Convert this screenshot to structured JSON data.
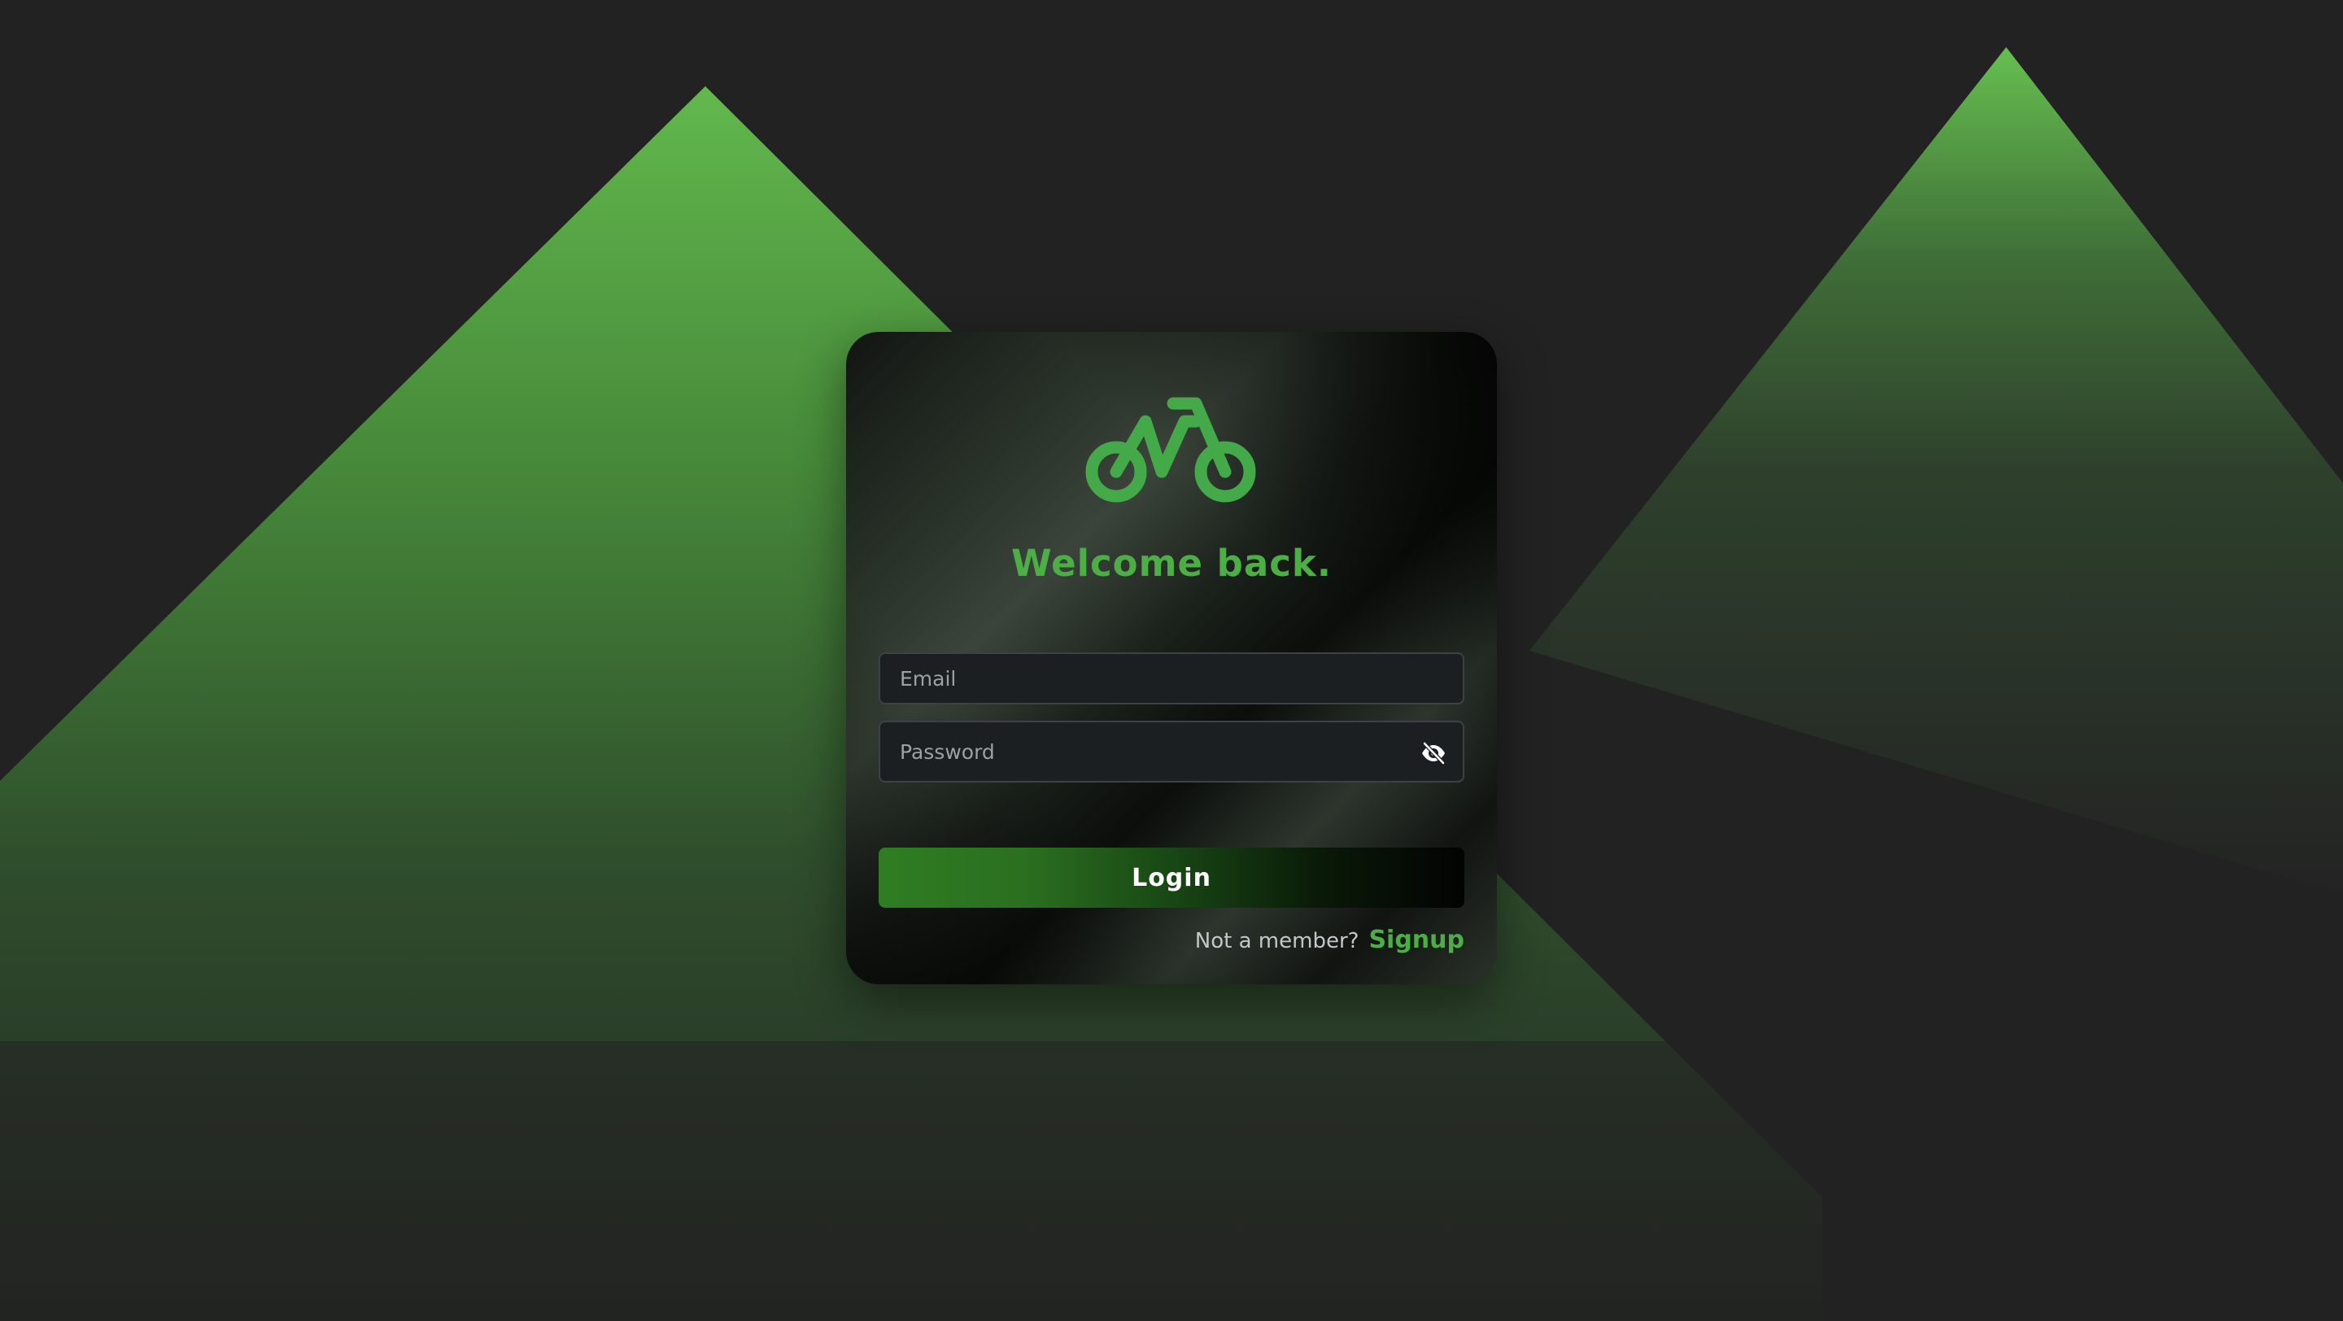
{
  "background": {
    "color": "#222222",
    "accent": "#5fb84f"
  },
  "login_card": {
    "logo_icon": "bicycle-logo-icon",
    "title": "Welcome back.",
    "email": {
      "placeholder": "Email",
      "value": ""
    },
    "password": {
      "placeholder": "Password",
      "value": "",
      "toggle_icon": "eye-slash-icon"
    },
    "login_label": "Login",
    "signup_prompt": "Not a member?",
    "signup_label": "Signup"
  },
  "colors": {
    "brand_green": "#4caf46",
    "field_bg": "#1b1f22",
    "field_border": "#3c4246"
  }
}
